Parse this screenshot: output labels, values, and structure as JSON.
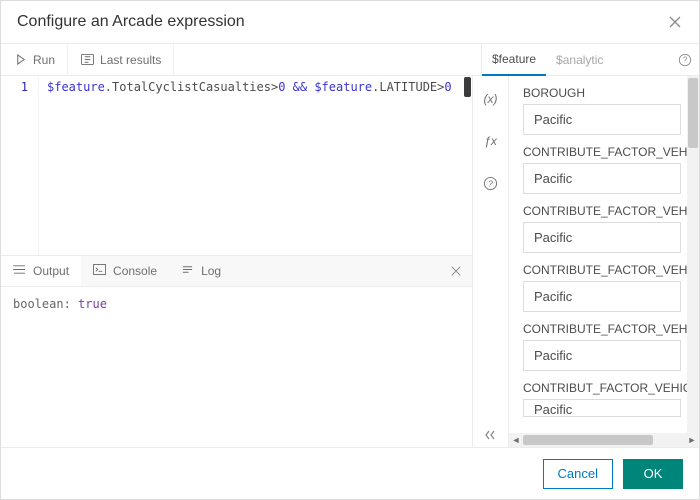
{
  "header": {
    "title": "Configure an Arcade expression"
  },
  "toolbar": {
    "run_label": "Run",
    "last_results_label": "Last results"
  },
  "right_tabs": {
    "feature_label": "$feature",
    "analytic_label": "$analytic"
  },
  "editor": {
    "line_number": "1",
    "tokens": {
      "t0": "$feature",
      "t1": ".TotalCyclistCasualties>",
      "t2": "0",
      "t3": " && ",
      "t4": "$feature",
      "t5": ".LATITUDE>",
      "t6": "0"
    }
  },
  "mid_buttons": {
    "vars_label": "(x)",
    "fx_label": "ƒx",
    "help_label": "?"
  },
  "panel_tabs": {
    "output_label": "Output",
    "console_label": "Console",
    "log_label": "Log"
  },
  "output": {
    "type_label": "boolean:",
    "value": "true"
  },
  "attributes": [
    {
      "label": "BOROUGH",
      "value": "Pacific"
    },
    {
      "label": "CONTRIBUTE_FACTOR_VEHICLE",
      "value": "Pacific"
    },
    {
      "label": "CONTRIBUTE_FACTOR_VEHICLE",
      "value": "Pacific"
    },
    {
      "label": "CONTRIBUTE_FACTOR_VEHICLE",
      "value": "Pacific"
    },
    {
      "label": "CONTRIBUTE_FACTOR_VEHICLE",
      "value": "Pacific"
    },
    {
      "label": "CONTRIBUT_FACTOR_VEHICLE_",
      "value": "Pacific"
    }
  ],
  "footer": {
    "cancel_label": "Cancel",
    "ok_label": "OK"
  }
}
